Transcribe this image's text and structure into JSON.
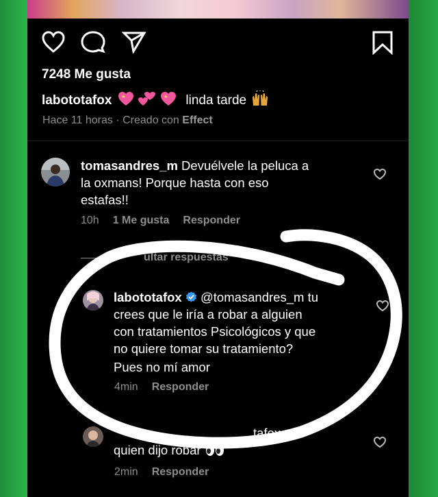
{
  "post": {
    "likes_label": "7248 Me gusta",
    "caption": {
      "username": "labototafox",
      "text": "linda tarde"
    },
    "meta": {
      "time": "Hace 11 horas",
      "separator": "·",
      "created_with": "Creado con",
      "effect": "Effect"
    }
  },
  "comments": [
    {
      "username": "tomasandres_m",
      "line1": "Devuélvele la peluca a",
      "line2": "la oxmans! Porque hasta con eso",
      "line3": "estafas!!",
      "time": "10h",
      "likes": "1 Me gusta",
      "reply": "Responder"
    }
  ],
  "replies_toggle": "Ocultar respuestas",
  "replies_toggle_visible": "ultar respuestas",
  "reply": {
    "username": "labototafox",
    "mention": "@tomasandres_m",
    "line1_tail": "tu",
    "line2": "crees que le iría a robar a alguien",
    "line3": "con tratamientos Psicológicos y que",
    "line4": "no quiere tomar su tratamiento?",
    "line5": "Pues no mí amor",
    "time": "4min",
    "reply": "Responder"
  },
  "reply2": {
    "username_partial": "",
    "mention_partial": "tafox",
    "text": "quien dijo robar",
    "time": "2min",
    "reply": "Responder"
  },
  "icons": [
    "heart-icon",
    "comment-icon",
    "share-icon",
    "bookmark-icon",
    "verified-badge-icon",
    "eyes-emoji"
  ],
  "colors": {
    "background": "#000000",
    "text": "#ffffff",
    "muted": "#8e8e8e",
    "frame": "#26a844",
    "verified": "#3897f0"
  }
}
